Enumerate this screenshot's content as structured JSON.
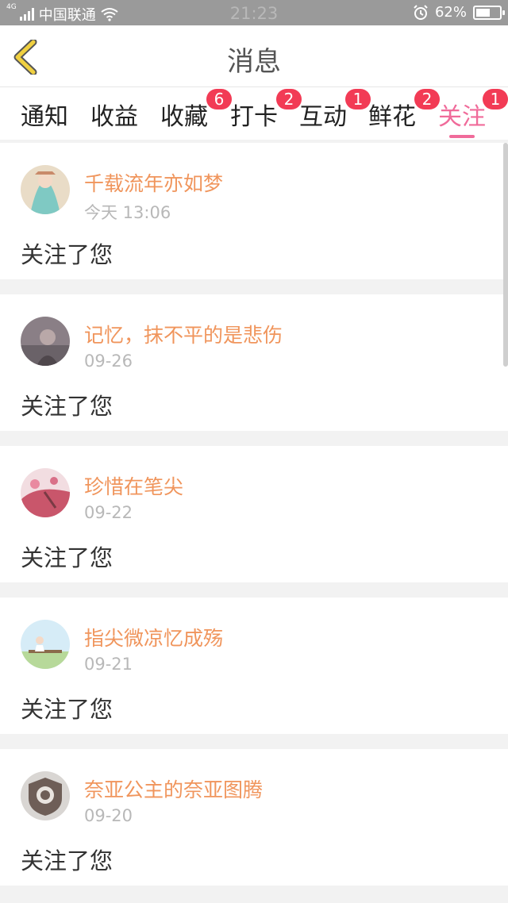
{
  "status_bar": {
    "network_type": "4G",
    "carrier": "中国联通",
    "time": "21:23",
    "battery": "62%",
    "battery_level": 0.62,
    "alarm_icon": "alarm-icon",
    "wifi_icon": "wifi-icon"
  },
  "nav": {
    "title": "消息",
    "back_icon": "chevron-left-icon",
    "accent": "#f0c030"
  },
  "tabs": [
    {
      "label": "通知",
      "badge": ""
    },
    {
      "label": "收益",
      "badge": ""
    },
    {
      "label": "收藏",
      "badge": "6"
    },
    {
      "label": "打卡",
      "badge": "2"
    },
    {
      "label": "互动",
      "badge": "1"
    },
    {
      "label": "鲜花",
      "badge": "2"
    },
    {
      "label": "关注",
      "badge": "1",
      "active": true
    }
  ],
  "items": [
    {
      "name": "千载流年亦如梦",
      "time": "今天 13:06",
      "message": "关注了您"
    },
    {
      "name": "记忆，抹不平的是悲伤",
      "time": "09-26",
      "message": "关注了您"
    },
    {
      "name": "珍惜在笔尖",
      "time": "09-22",
      "message": "关注了您"
    },
    {
      "name": "指尖微凉忆成殇",
      "time": "09-21",
      "message": "关注了您"
    },
    {
      "name": "奈亚公主的奈亚图腾",
      "time": "09-20",
      "message": "关注了您"
    }
  ],
  "colors": {
    "active_tab": "#f06b9a",
    "name": "#f0955c",
    "badge": "#f23b55"
  }
}
